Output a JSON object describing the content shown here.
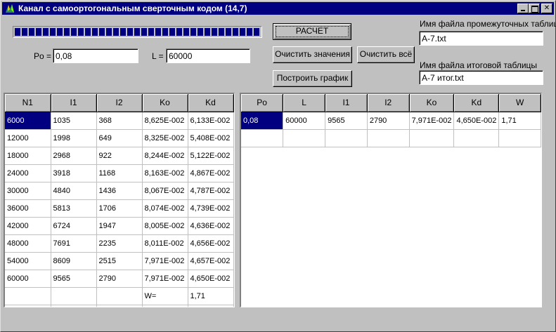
{
  "window": {
    "title": "Канал с самоортогональным сверточным кодом (14,7)"
  },
  "progress": {
    "value": 1.0,
    "color": "#000080"
  },
  "form": {
    "po_label": "Po =",
    "po_value": "0,08",
    "l_label": "L =",
    "l_value": "60000"
  },
  "buttons": {
    "calc": "РАСЧЕТ",
    "clear_values": "Очистить значения",
    "clear_all": "Очистить всё",
    "plot": "Построить график"
  },
  "files": {
    "intermediate_label": "Имя файла промежуточных таблиц",
    "intermediate_value": "A-7.txt",
    "final_label": "Имя файла итоговой таблицы",
    "final_value": "A-7 итог.txt"
  },
  "left_table": {
    "headers": [
      "N1",
      "I1",
      "I2",
      "Ko",
      "Kd"
    ],
    "rows": [
      [
        "6000",
        "1035",
        "368",
        "8,625E-002",
        "6,133E-002"
      ],
      [
        "12000",
        "1998",
        "649",
        "8,325E-002",
        "5,408E-002"
      ],
      [
        "18000",
        "2968",
        "922",
        "8,244E-002",
        "5,122E-002"
      ],
      [
        "24000",
        "3918",
        "1168",
        "8,163E-002",
        "4,867E-002"
      ],
      [
        "30000",
        "4840",
        "1436",
        "8,067E-002",
        "4,787E-002"
      ],
      [
        "36000",
        "5813",
        "1706",
        "8,074E-002",
        "4,739E-002"
      ],
      [
        "42000",
        "6724",
        "1947",
        "8,005E-002",
        "4,636E-002"
      ],
      [
        "48000",
        "7691",
        "2235",
        "8,011E-002",
        "4,656E-002"
      ],
      [
        "54000",
        "8609",
        "2515",
        "7,971E-002",
        "4,657E-002"
      ],
      [
        "60000",
        "9565",
        "2790",
        "7,971E-002",
        "4,650E-002"
      ],
      [
        "",
        "",
        "",
        "W=",
        "1,71"
      ],
      [
        "",
        "",
        "",
        "",
        ""
      ]
    ]
  },
  "right_table": {
    "headers": [
      "Po",
      "L",
      "I1",
      "I2",
      "Ko",
      "Kd",
      "W"
    ],
    "rows": [
      [
        "0,08",
        "60000",
        "9565",
        "2790",
        "7,971E-002",
        "4,650E-002",
        "1,71"
      ],
      [
        "",
        "",
        "",
        "",
        "",
        "",
        ""
      ]
    ]
  }
}
